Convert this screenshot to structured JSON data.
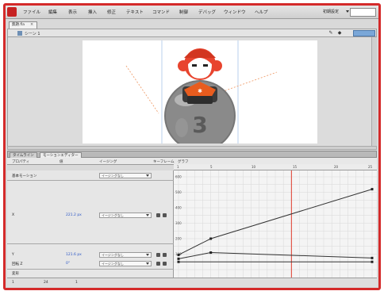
{
  "menubar": {
    "items": [
      "ファイル",
      "編集",
      "表示",
      "挿入",
      "修正",
      "テキスト",
      "コマンド",
      "制御",
      "デバッグ",
      "ウィンドウ",
      "ヘルプ"
    ],
    "workspace": "初期設定",
    "brand_color": "#c62222"
  },
  "document": {
    "tab_label": "無題.fla"
  },
  "stage_toolbar": {
    "scene_label": "シーン 1",
    "icons": [
      "edit-symbols-icon",
      "scene-icon"
    ]
  },
  "stage": {
    "ball_number": "3",
    "character": "red-hat-monkey-on-gray-ball"
  },
  "timeline": {
    "tabs": [
      "タイムライン",
      "モーションエディター"
    ],
    "active_tab": 1,
    "columns": [
      "プロパティ",
      "値",
      "イージング",
      "キーフレーム",
      "グラフ"
    ],
    "ruler_labels": [
      "1",
      "5",
      "10",
      "15",
      "20",
      "25"
    ],
    "playhead_frame": 15,
    "properties": [
      {
        "name": "基本モーション",
        "value": "",
        "ease": "イージングなし"
      },
      {
        "name": "X",
        "value": "221.2 px",
        "ease": "イージングなし"
      },
      {
        "name": "Y",
        "value": "121.6 px",
        "ease": "イージングなし"
      },
      {
        "name": "回転 Z",
        "value": "0°",
        "ease": "イージングなし"
      },
      {
        "name": "変形",
        "value": "",
        "ease": ""
      }
    ],
    "graph_y_labels": [
      "600",
      "500",
      "400",
      "300",
      "200",
      "100"
    ],
    "status": [
      "1",
      "24",
      "1"
    ]
  },
  "chart_data": {
    "type": "line",
    "series": [
      {
        "name": "X",
        "x": [
          1,
          5,
          25
        ],
        "y": [
          95,
          200,
          520
        ]
      },
      {
        "name": "Y",
        "x": [
          1,
          5,
          25
        ],
        "y": [
          70,
          110,
          75
        ]
      },
      {
        "name": "回転 Z",
        "x": [
          1,
          25
        ],
        "y": [
          50,
          50
        ]
      }
    ],
    "xlim": [
      1,
      25
    ],
    "ylim": [
      0,
      600
    ],
    "grid": true
  }
}
